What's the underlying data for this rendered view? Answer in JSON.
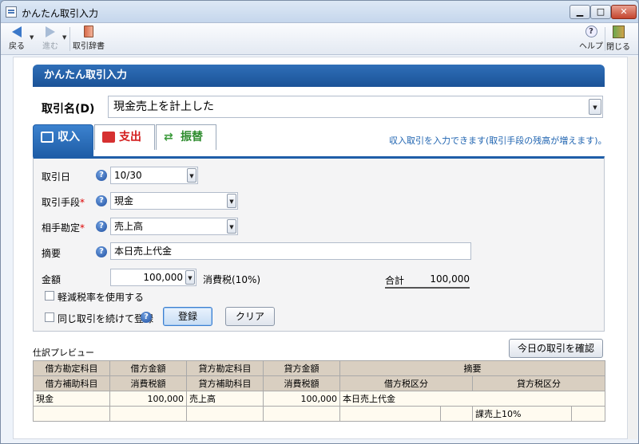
{
  "window": {
    "title": "かんたん取引入力",
    "controls": {
      "minimize": "▁",
      "maximize": "□",
      "close": "✕"
    }
  },
  "toolbar": {
    "back_label": "戻る",
    "forward_label": "進む",
    "dictionary_label": "取引辞書",
    "help_label": "ヘルプ",
    "close_label": "閉じる"
  },
  "header": {
    "title": "かんたん取引入力"
  },
  "transaction_name": {
    "label": "取引名(D)",
    "value": "現金売上を計上した"
  },
  "tabs": [
    {
      "label": "収入",
      "selected": true,
      "icon": "income-icon"
    },
    {
      "label": "支出",
      "selected": false,
      "icon": "expense-icon"
    },
    {
      "label": "振替",
      "selected": false,
      "icon": "transfer-icon"
    }
  ],
  "tab_hint": "収入取引を入力できます(取引手段の残高が増えます)。",
  "form": {
    "date": {
      "label": "取引日",
      "value": "10/30"
    },
    "method": {
      "label": "取引手段",
      "required": "*",
      "value": "現金"
    },
    "counter_account": {
      "label": "相手勘定",
      "required": "*",
      "value": "売上高"
    },
    "memo": {
      "label": "摘要",
      "value": "本日売上代金"
    },
    "amount": {
      "label": "金額",
      "value": "100,000"
    },
    "tax_label": "消費税(10%)",
    "total_label": "合計",
    "total_value": "100,000",
    "reduced_tax_checkbox": "軽減税率を使用する",
    "repeat_checkbox": "同じ取引を続けて登録",
    "register_button": "登録",
    "clear_button": "クリア"
  },
  "preview": {
    "label": "仕訳プレビュー",
    "check_today_button": "今日の取引を確認",
    "header_row1": [
      "借方勘定科目",
      "借方金額",
      "貸方勘定科目",
      "貸方金額",
      "摘要"
    ],
    "header_row2": [
      "借方補助科目",
      "消費税額",
      "貸方補助科目",
      "消費税額",
      "借方税区分",
      "貸方税区分"
    ],
    "row1": {
      "debit_account": "現金",
      "debit_amount": "100,000",
      "credit_account": "売上高",
      "credit_amount": "100,000",
      "memo": "本日売上代金"
    },
    "row2": {
      "credit_tax_class": "課売上10%"
    }
  },
  "colors": {
    "accent": "#1f5ea8",
    "expense": "#d31b1b",
    "transfer": "#2d8b2d",
    "table_header": "#d9cfc1"
  }
}
